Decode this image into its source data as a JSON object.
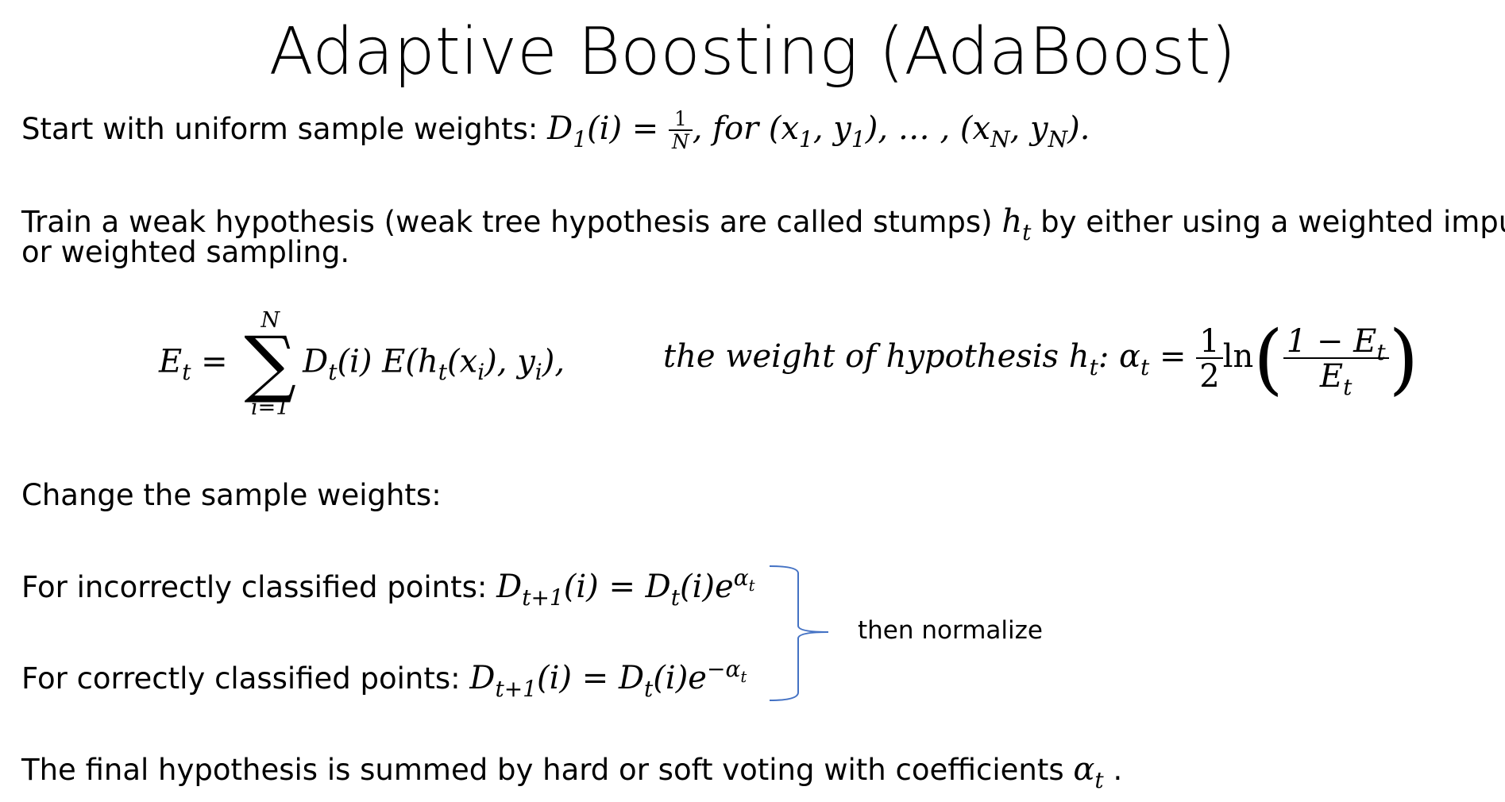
{
  "title": "Adaptive Boosting (AdaBoost)",
  "line1": {
    "text": "Start with uniform sample weights: ",
    "lhs": "D",
    "lhs_sub": "1",
    "lhs_arg": "(i) = ",
    "frac_num": "1",
    "frac_den": "N",
    "rest": ", for (x",
    "s1": "1",
    "c1": ", y",
    "s2": "1",
    "mid": "), … , (x",
    "s3": "N",
    "c2": ", y",
    "s4": "N",
    "end": ")."
  },
  "line2": {
    "text_a": "Train a weak hypothesis (weak tree hypothesis are called stumps) ",
    "h": "h",
    "h_sub": "t",
    "text_b": " by either using a weighted impurity",
    "text_c": "or weighted sampling."
  },
  "formula_error": {
    "lhs": "E",
    "lhs_sub": "t",
    "eq": " = ",
    "sigma": "∑",
    "upper": "N",
    "lower": "i=1",
    "body_a": "D",
    "body_a_sub": "t",
    "body_b": "(i)  E(h",
    "body_b_sub": "t",
    "body_c": "(x",
    "body_c_sub": "i",
    "body_d": "), y",
    "body_d_sub": "i",
    "body_e": "),"
  },
  "formula_alpha": {
    "text": "the weight of hypothesis h",
    "text_sub": "t",
    "colon": ": α",
    "alpha_sub": "t",
    "eq": " = ",
    "half_num": "1",
    "half_den": "2",
    "ln": "ln",
    "lparen": "(",
    "num": "1 − E",
    "num_sub": "t",
    "den": "E",
    "den_sub": "t",
    "rparen": ")"
  },
  "line3": {
    "text": "Change the sample weights:"
  },
  "line4": {
    "text": "For incorrectly classified points: ",
    "a": "D",
    "a_sub": "t+1",
    "b": "(i) = D",
    "b_sub": "t",
    "c": "(i)e",
    "exp": "α",
    "exp_sub": "t"
  },
  "line5": {
    "text": "For correctly classified points: ",
    "a": "D",
    "a_sub": "t+1",
    "b": "(i) = D",
    "b_sub": "t",
    "c": "(i)e",
    "exp": "−α",
    "exp_sub": "t"
  },
  "brace_note": "then normalize",
  "line6": {
    "text": "The final hypothesis is summed by hard or soft voting with coefficients ",
    "a": "α",
    "a_sub": "t",
    "end": " ."
  },
  "colors": {
    "brace": "#4472c4",
    "text": "#000000"
  }
}
